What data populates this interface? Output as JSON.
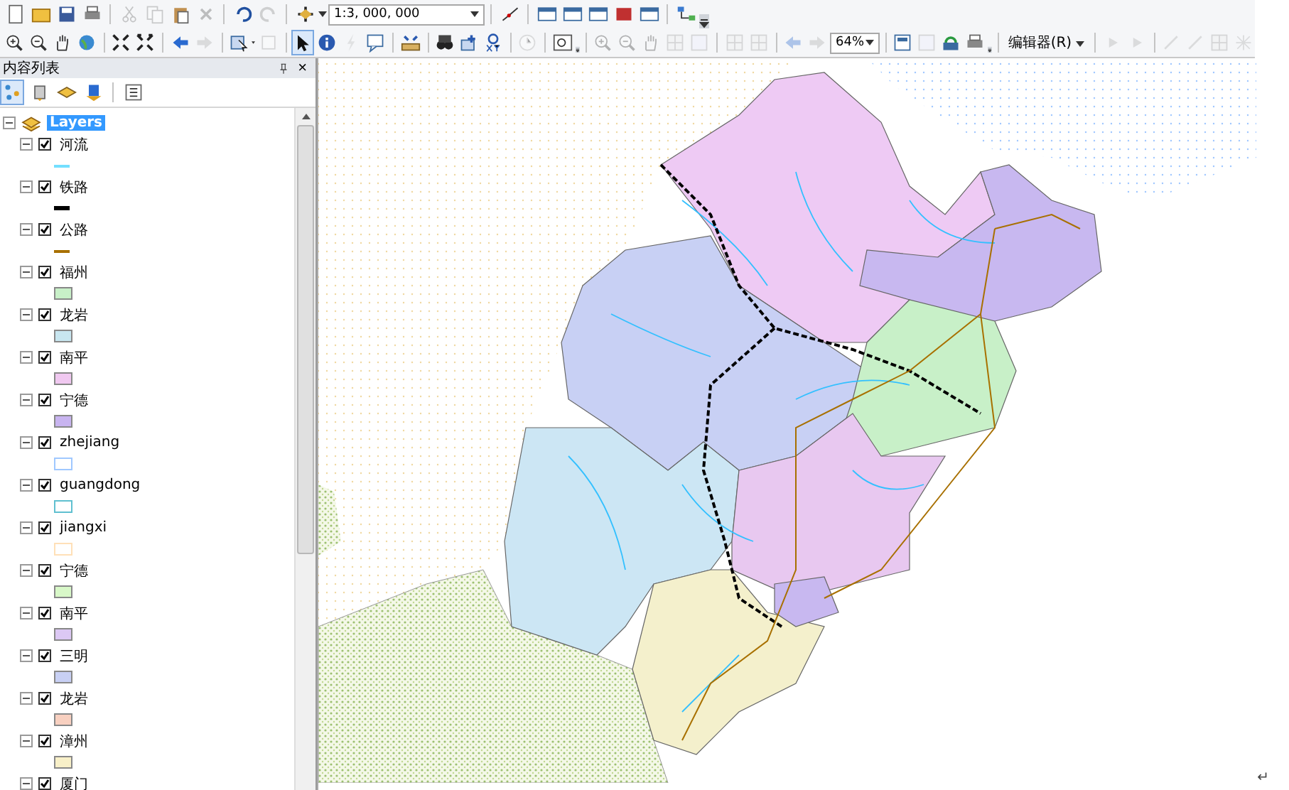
{
  "toolbar": {
    "scale": "1:3, 000, 000",
    "select_tool_selected": true,
    "layout_zoom": "64%",
    "editor_menu": "编辑器(R)"
  },
  "toc": {
    "title": "内容列表",
    "close": "×",
    "root": {
      "name": "Layers",
      "selected": true,
      "expanded": true
    },
    "layers": [
      {
        "name": "河流",
        "checked": true,
        "expanded": true,
        "symbol": {
          "kind": "line",
          "color": "#73dfff"
        }
      },
      {
        "name": "铁路",
        "checked": true,
        "expanded": true,
        "symbol": {
          "kind": "rail",
          "color": "#000000"
        }
      },
      {
        "name": "公路",
        "checked": true,
        "expanded": true,
        "symbol": {
          "kind": "line",
          "color": "#a87000"
        }
      },
      {
        "name": "福州",
        "checked": true,
        "expanded": true,
        "symbol": {
          "kind": "fill",
          "color": "#c8f0c8"
        }
      },
      {
        "name": "龙岩",
        "checked": true,
        "expanded": true,
        "symbol": {
          "kind": "fill",
          "color": "#c8e6f0"
        }
      },
      {
        "name": "南平",
        "checked": true,
        "expanded": true,
        "symbol": {
          "kind": "fill",
          "color": "#f0c8f0"
        }
      },
      {
        "name": "宁德",
        "checked": true,
        "expanded": true,
        "symbol": {
          "kind": "fill",
          "color": "#c8b4f0"
        }
      },
      {
        "name": "zhejiang",
        "checked": true,
        "expanded": true,
        "symbol": {
          "kind": "pattern",
          "color": "#a0c8ff"
        }
      },
      {
        "name": "guangdong",
        "checked": true,
        "expanded": true,
        "symbol": {
          "kind": "pattern",
          "color": "#60c0d0"
        }
      },
      {
        "name": "jiangxi",
        "checked": true,
        "expanded": true,
        "symbol": {
          "kind": "pattern",
          "color": "#ffe0b8"
        }
      },
      {
        "name": "宁德",
        "checked": true,
        "expanded": true,
        "symbol": {
          "kind": "fill",
          "color": "#d8f8c8"
        }
      },
      {
        "name": "南平",
        "checked": true,
        "expanded": true,
        "symbol": {
          "kind": "fill",
          "color": "#dcc8f4"
        }
      },
      {
        "name": "三明",
        "checked": true,
        "expanded": true,
        "symbol": {
          "kind": "fill",
          "color": "#c8d0f4"
        }
      },
      {
        "name": "龙岩",
        "checked": true,
        "expanded": true,
        "symbol": {
          "kind": "fill",
          "color": "#f8d0c0"
        }
      },
      {
        "name": "漳州",
        "checked": true,
        "expanded": true,
        "symbol": {
          "kind": "fill",
          "color": "#f8f0c8"
        }
      },
      {
        "name": "厦门",
        "checked": true,
        "expanded": true
      }
    ]
  },
  "page_end_mark": "↵"
}
